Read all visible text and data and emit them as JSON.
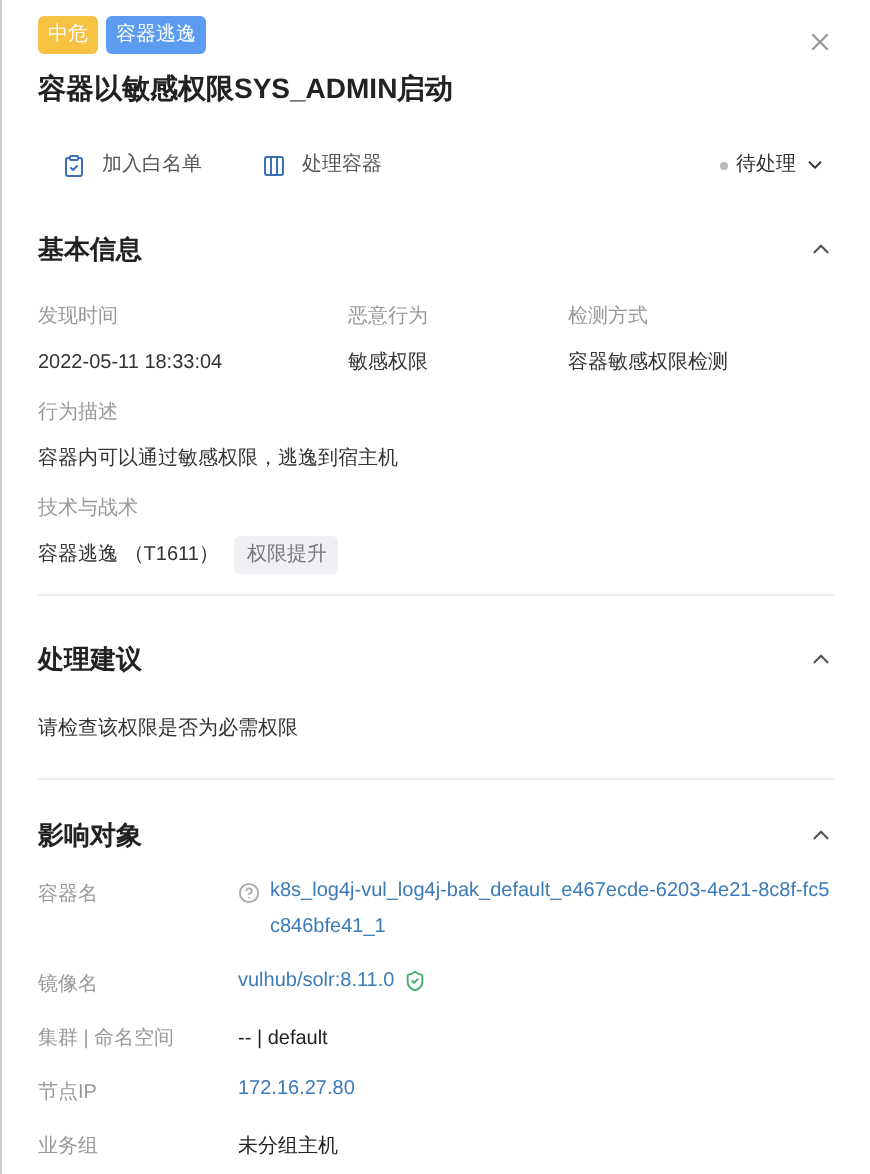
{
  "tags": [
    {
      "label": "中危",
      "color": "#f5c242"
    },
    {
      "label": "容器逃逸",
      "color": "#5b9bf0"
    }
  ],
  "title": "容器以敏感权限SYS_ADMIN启动",
  "actions": [
    {
      "label": "加入白名单",
      "kind": "whitelist"
    },
    {
      "label": "处理容器",
      "kind": "container"
    }
  ],
  "status": {
    "label": "待处理"
  },
  "basic_info": {
    "title": "基本信息",
    "expanded": true,
    "fields": [
      {
        "label": "发现时间",
        "value": "2022-05-11 18:33:04"
      },
      {
        "label": "恶意行为",
        "value": "敏感权限"
      },
      {
        "label": "检测方式",
        "value": "容器敏感权限检测"
      }
    ],
    "description": {
      "label": "行为描述",
      "value": "容器内可以通过敏感权限，逃逸到宿主机"
    },
    "tactics": {
      "label": "技术与战术",
      "value": "容器逃逸 （T1611）",
      "tag": "权限提升"
    }
  },
  "suggestion": {
    "title": "处理建议",
    "expanded": true,
    "text": "请检查该权限是否为必需权限"
  },
  "impact": {
    "title": "影响对象",
    "expanded": true,
    "rows": [
      {
        "label": "容器名",
        "value": "k8s_log4j-vul_log4j-bak_default_e467ecde-6203-4e21-8c8f-fc5c846bfe41_1",
        "kind": "link-help"
      },
      {
        "label": "镜像名",
        "value": "vulhub/solr:8.11.0",
        "kind": "link-verified"
      },
      {
        "label": "集群 | 命名空间",
        "value": "-- | default",
        "kind": "text"
      },
      {
        "label": "节点IP",
        "value": "172.16.27.80",
        "kind": "link"
      },
      {
        "label": "业务组",
        "value": "未分组主机",
        "kind": "text"
      }
    ]
  }
}
